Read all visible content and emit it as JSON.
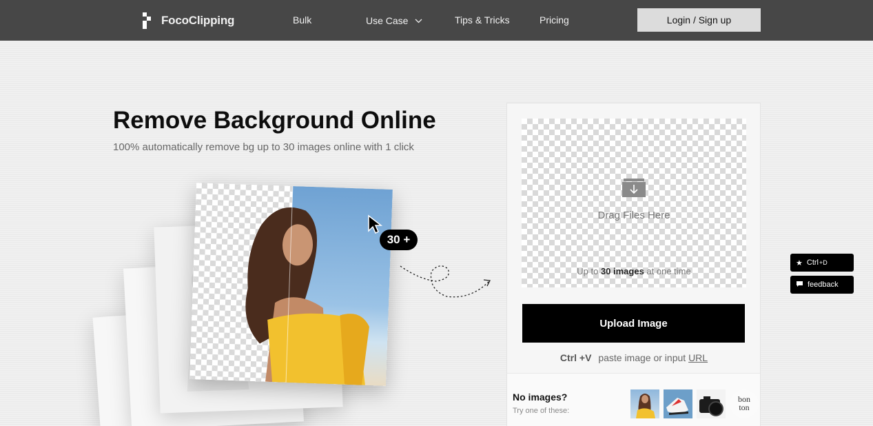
{
  "header": {
    "logo_text": "FocoClipping",
    "nav": [
      {
        "label": "Bulk"
      },
      {
        "label": "Use Case"
      },
      {
        "label": "Tips & Tricks"
      },
      {
        "label": "Pricing"
      }
    ],
    "login_label": "Login / Sign up"
  },
  "hero": {
    "title": "Remove Background Online",
    "subtitle": "100% automatically remove bg up to 30 images online with 1 click",
    "badge": "30 +"
  },
  "upload": {
    "drag_text": "Drag Files Here",
    "limit_prefix": "Up to ",
    "limit_bold": "30 images",
    "limit_suffix": " at one time",
    "button_label": "Upload Image",
    "paste_shortcut": "Ctrl +V",
    "paste_text": "paste image or input ",
    "paste_link": "URL"
  },
  "samples": {
    "heading": "No images?",
    "hint": "Try one of these:",
    "items": [
      "woman",
      "sneakers",
      "camera",
      "bonton-logo"
    ],
    "bonton_line1": "bon",
    "bonton_line2": "ton"
  },
  "side": {
    "bookmark_label": "Ctrl",
    "bookmark_key": "+D",
    "feedback_label": "feedback"
  },
  "colors": {
    "header_bg": "#474747",
    "accent": "#000000",
    "login_bg": "#dcdcdc"
  }
}
